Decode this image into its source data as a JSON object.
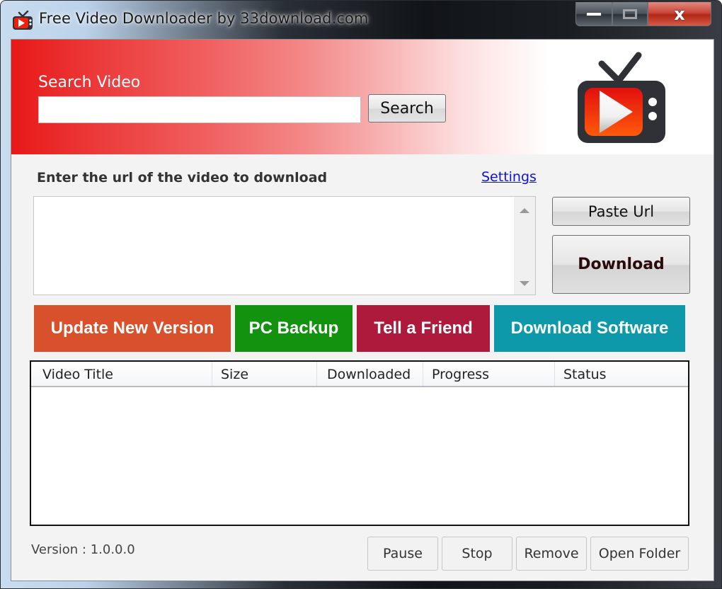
{
  "window": {
    "title": "Free Video Downloader by 33download.com",
    "app_icon": "tv-play-icon",
    "caption_buttons": {
      "minimize_icon": "minimize-icon",
      "maximize_icon": "maximize-icon",
      "close_icon": "close-icon",
      "close_glyph": "x"
    }
  },
  "search": {
    "label": "Search Video",
    "input_value": "",
    "button_label": "Search"
  },
  "logo": {
    "icon": "tv-play-logo",
    "colors": {
      "tv_body": "#2f3136",
      "screen_top": "#e20f0f",
      "screen_bottom": "#ff5a0a"
    }
  },
  "url_section": {
    "label": "Enter the url of the video to download",
    "settings_link": "Settings",
    "textarea_value": "",
    "paste_button": "Paste Url",
    "download_button": "Download"
  },
  "promo_buttons": [
    {
      "label": "Update New Version",
      "color": "#d9502c"
    },
    {
      "label": "PC Backup",
      "color": "#12920f"
    },
    {
      "label": "Tell a Friend",
      "color": "#ad1a3c"
    },
    {
      "label": "Download Software",
      "color": "#0e99aa"
    }
  ],
  "downloads_table": {
    "columns": [
      "Video Title",
      "Size",
      "Downloaded",
      "Progress",
      "Status"
    ],
    "rows": []
  },
  "footer": {
    "version": "Version : 1.0.0.0",
    "buttons": [
      "Pause",
      "Stop",
      "Remove",
      "Open Folder"
    ]
  }
}
